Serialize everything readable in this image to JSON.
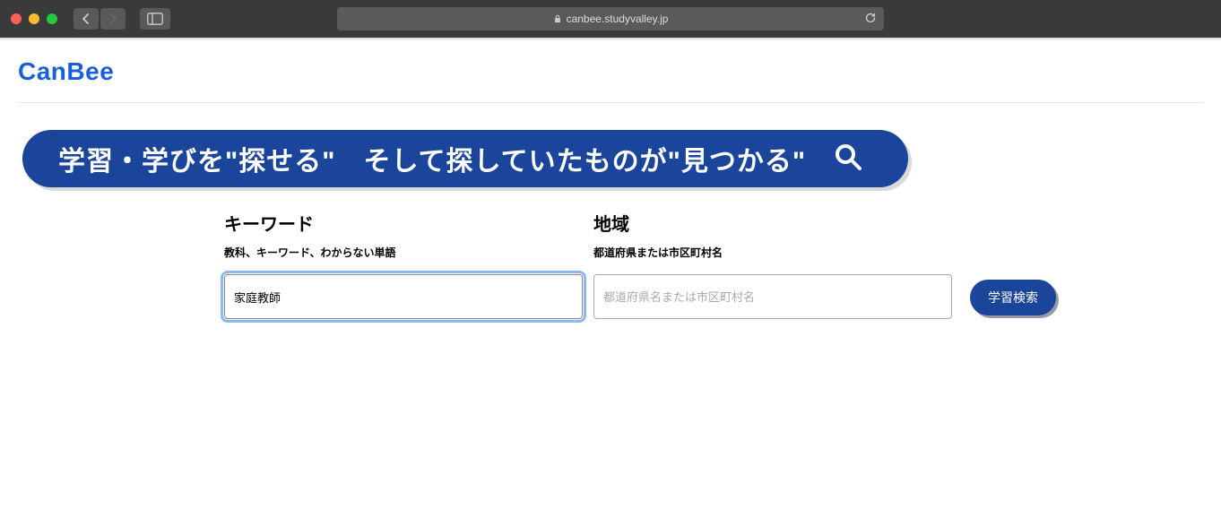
{
  "browser": {
    "url": "canbee.studyvalley.jp"
  },
  "logo": "CanBee",
  "hero": {
    "text": "学習・学びを\"探せる\"　そして探していたものが\"見つかる\""
  },
  "form": {
    "keyword": {
      "label": "キーワード",
      "sublabel": "教科、キーワード、わからない単語",
      "value": "家庭教師"
    },
    "region": {
      "label": "地域",
      "sublabel": "都道府県または市区町村名",
      "placeholder": "都道府県名または市区町村名",
      "value": ""
    },
    "submit_label": "学習検索"
  }
}
